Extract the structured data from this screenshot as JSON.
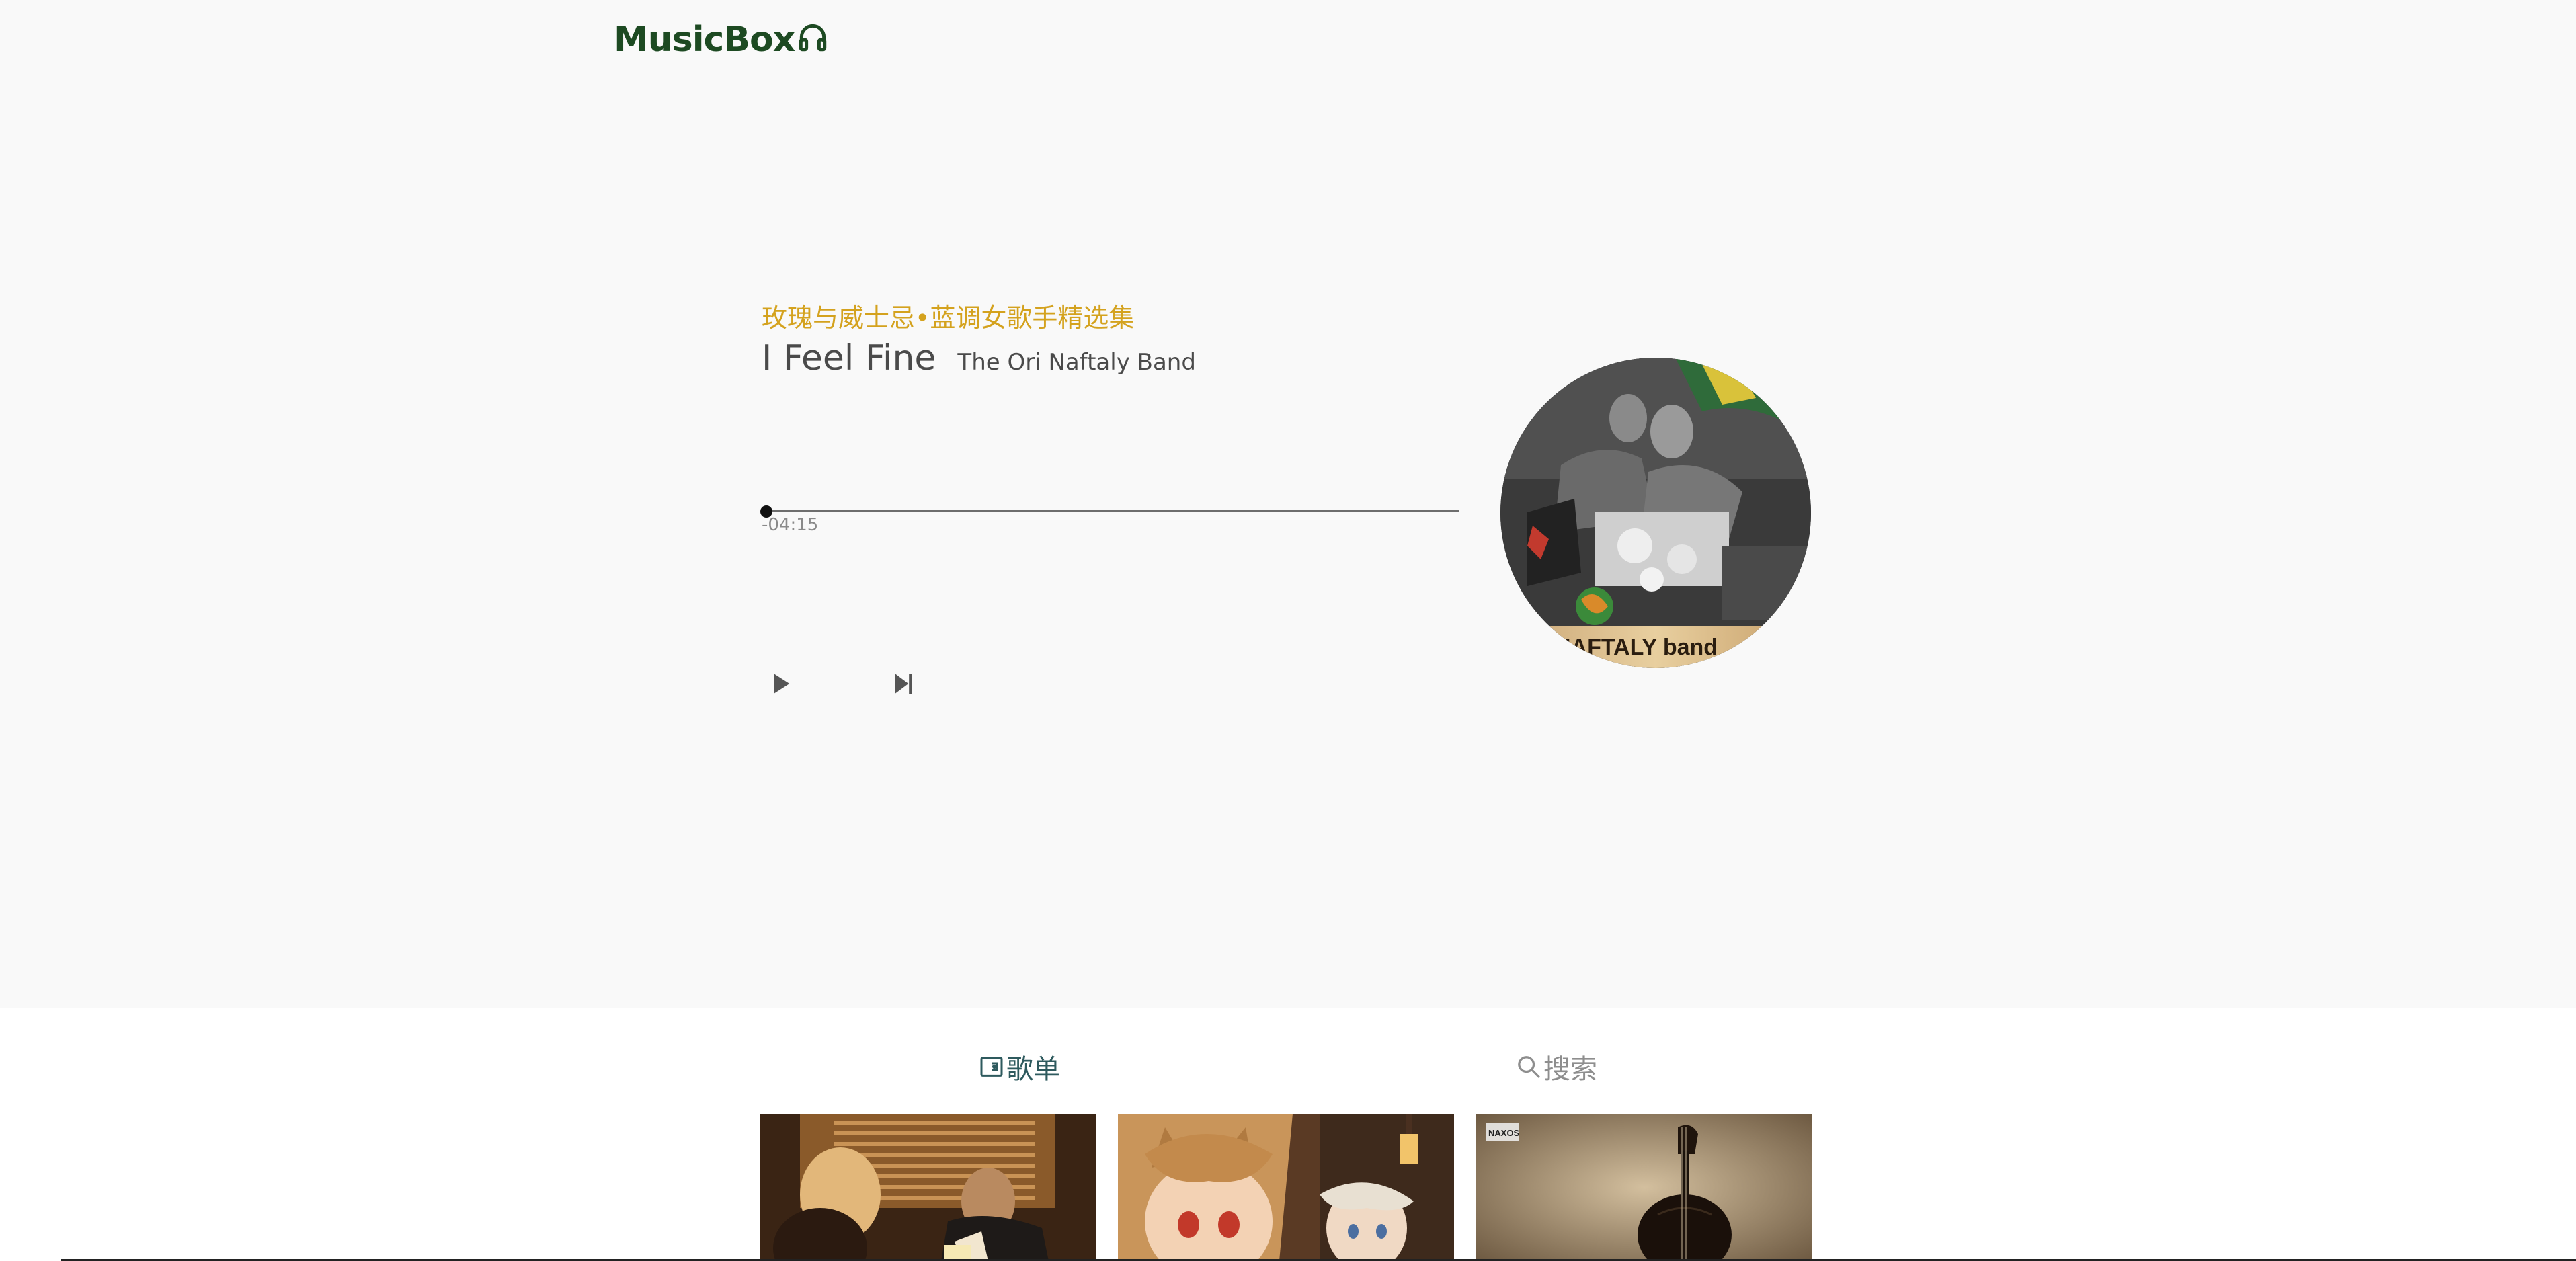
{
  "app": {
    "logo_text": "MusicBox",
    "logo_icon": "headphones-icon"
  },
  "now_playing": {
    "playlist_name": "玫瑰与威士忌•蓝调女歌手精选集",
    "song_title": "I Feel Fine",
    "artist": "The Ori Naftaly Band",
    "time_remaining": "-04:15",
    "progress_fraction": 0.0,
    "album_art_text": "NAFTALY band"
  },
  "controls": {
    "play_icon": "play-icon",
    "next_icon": "skip-next-icon"
  },
  "tabs": [
    {
      "label": "歌单",
      "icon": "playlist-icon",
      "active": true
    },
    {
      "label": "搜索",
      "icon": "search-icon",
      "active": false
    }
  ],
  "cards": [
    {
      "image": "playlist-cover-couple"
    },
    {
      "image": "playlist-cover-anime"
    },
    {
      "image": "playlist-cover-violin",
      "badge_text": "NAXOS"
    }
  ],
  "colors": {
    "logo": "#1d4a22",
    "playlist_name": "#d4a21e",
    "active_tab": "#2e5a5e",
    "inactive_tab": "#8e8e8e",
    "player_bg": "#f9f9f9"
  }
}
